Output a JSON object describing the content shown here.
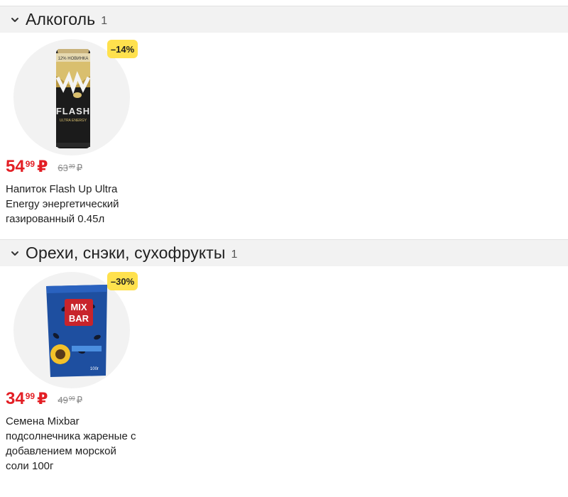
{
  "sections": [
    {
      "title": "Алкоголь",
      "count": "1",
      "product": {
        "discount": "–14%",
        "price_main": "54",
        "price_cents": "99",
        "currency": "₽",
        "old_price_main": "63",
        "old_price_cents": "39",
        "old_currency": "₽",
        "name": "Напиток Flash Up Ultra Energy энергетический газированный 0.45л",
        "image_text_top": "12% НОВИНКА",
        "image_text_brand": "FLASH",
        "image_text_sub": "ULTRA ENERGY"
      }
    },
    {
      "title": "Орехи, снэки, сухофрукты",
      "count": "1",
      "product": {
        "discount": "–30%",
        "price_main": "34",
        "price_cents": "99",
        "currency": "₽",
        "old_price_main": "49",
        "old_price_cents": "99",
        "old_currency": "₽",
        "name": "Семена Mixbar подсолнечника жареные с добавлением морской соли 100г",
        "image_text_brand1": "MIX",
        "image_text_brand2": "BAR",
        "image_text_weight": "100г"
      }
    }
  ],
  "colors": {
    "price": "#e31e24",
    "badge": "#ffe14d",
    "header_bg": "#f2f2f2"
  },
  "icons": {
    "section_toggle": "chevron-down-icon"
  }
}
